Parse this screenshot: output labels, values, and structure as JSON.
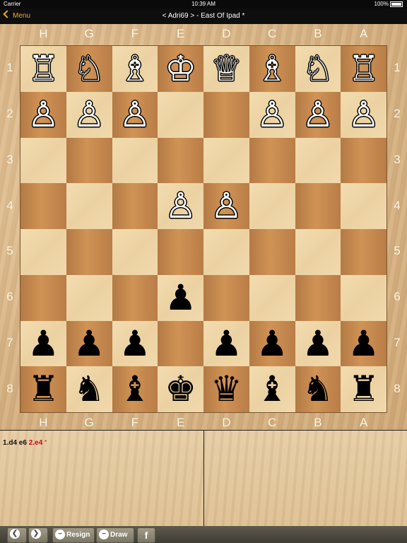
{
  "status": {
    "carrier": "Carrier",
    "time": "10:39 AM",
    "battery": "100%"
  },
  "nav": {
    "back_label": "Menu",
    "title": "< Adri69 > - East Of Ipad *"
  },
  "board": {
    "files": [
      "H",
      "G",
      "F",
      "E",
      "D",
      "C",
      "B",
      "A"
    ],
    "ranks": [
      "1",
      "2",
      "3",
      "4",
      "5",
      "6",
      "7",
      "8"
    ],
    "rows": [
      [
        {
          "c": "w",
          "p": "rook"
        },
        {
          "c": "w",
          "p": "knight"
        },
        {
          "c": "w",
          "p": "bishop"
        },
        {
          "c": "w",
          "p": "king"
        },
        {
          "c": "w",
          "p": "queen"
        },
        {
          "c": "w",
          "p": "bishop"
        },
        {
          "c": "w",
          "p": "knight"
        },
        {
          "c": "w",
          "p": "rook"
        }
      ],
      [
        {
          "c": "w",
          "p": "pawn"
        },
        {
          "c": "w",
          "p": "pawn"
        },
        {
          "c": "w",
          "p": "pawn"
        },
        null,
        null,
        {
          "c": "w",
          "p": "pawn"
        },
        {
          "c": "w",
          "p": "pawn"
        },
        {
          "c": "w",
          "p": "pawn"
        }
      ],
      [
        null,
        null,
        null,
        null,
        null,
        null,
        null,
        null
      ],
      [
        null,
        null,
        null,
        {
          "c": "w",
          "p": "pawn"
        },
        {
          "c": "w",
          "p": "pawn"
        },
        null,
        null,
        null
      ],
      [
        null,
        null,
        null,
        null,
        null,
        null,
        null,
        null
      ],
      [
        null,
        null,
        null,
        {
          "c": "b",
          "p": "pawn"
        },
        null,
        null,
        null,
        null
      ],
      [
        {
          "c": "b",
          "p": "pawn"
        },
        {
          "c": "b",
          "p": "pawn"
        },
        {
          "c": "b",
          "p": "pawn"
        },
        null,
        {
          "c": "b",
          "p": "pawn"
        },
        {
          "c": "b",
          "p": "pawn"
        },
        {
          "c": "b",
          "p": "pawn"
        },
        {
          "c": "b",
          "p": "pawn"
        }
      ],
      [
        {
          "c": "b",
          "p": "rook"
        },
        {
          "c": "b",
          "p": "knight"
        },
        {
          "c": "b",
          "p": "bishop"
        },
        {
          "c": "b",
          "p": "king"
        },
        {
          "c": "b",
          "p": "queen"
        },
        {
          "c": "b",
          "p": "bishop"
        },
        {
          "c": "b",
          "p": "knight"
        },
        {
          "c": "b",
          "p": "rook"
        }
      ]
    ]
  },
  "moves": {
    "previous": "1.d4 e6",
    "current": "2.e4",
    "marker": "*"
  },
  "toolbar": {
    "prev_icon": "back-arrow-icon",
    "next_icon": "forward-arrow-icon",
    "resign_label": "Resign",
    "draw_label": "Draw",
    "share_icon": "facebook-icon",
    "share_glyph": "f"
  },
  "colors": {
    "accent": "#f6a623",
    "current_move": "#d0021b",
    "light_square": "#f0d8aa",
    "dark_square": "#c58a50"
  }
}
